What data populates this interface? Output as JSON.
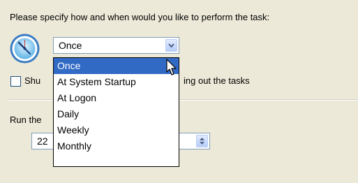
{
  "instruction": "Please specify how and when would you like to perform the task:",
  "schedule": {
    "selected": "Once",
    "options": [
      "Once",
      "At System Startup",
      "At Logon",
      "Daily",
      "Weekly",
      "Monthly"
    ]
  },
  "checkbox": {
    "label_visible_left": "Shu",
    "label_visible_right": "ing out the tasks",
    "checked": false
  },
  "run_label": "Run the",
  "spin": {
    "value": "22"
  },
  "icons": {
    "clock": "clock-icon",
    "dropdown_arrow": "chevron-down-icon",
    "spin": "spin-arrows-icon",
    "cursor": "mouse-pointer-icon"
  }
}
